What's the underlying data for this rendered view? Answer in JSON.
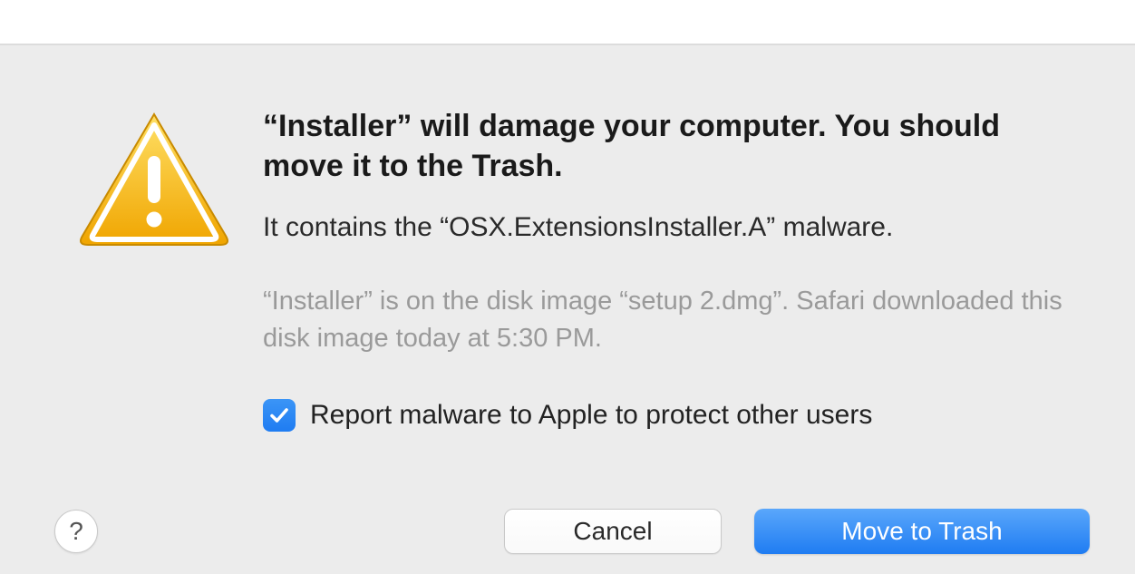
{
  "dialog": {
    "title": "“Installer” will damage your computer. You should move it to the Trash.",
    "subtitle": "It contains the “OSX.ExtensionsInstaller.A” malware.",
    "info": "“Installer” is on the disk image “setup 2.dmg”. Safari downloaded this disk image today at 5:30 PM.",
    "checkbox": {
      "checked": true,
      "label": "Report malware to Apple to protect other users"
    },
    "buttons": {
      "help": "?",
      "cancel": "Cancel",
      "primary": "Move to Trash"
    },
    "icon": "warning-triangle-icon",
    "colors": {
      "accent": "#2a85f4",
      "background": "#ececec",
      "warning": "#f5b400"
    }
  }
}
